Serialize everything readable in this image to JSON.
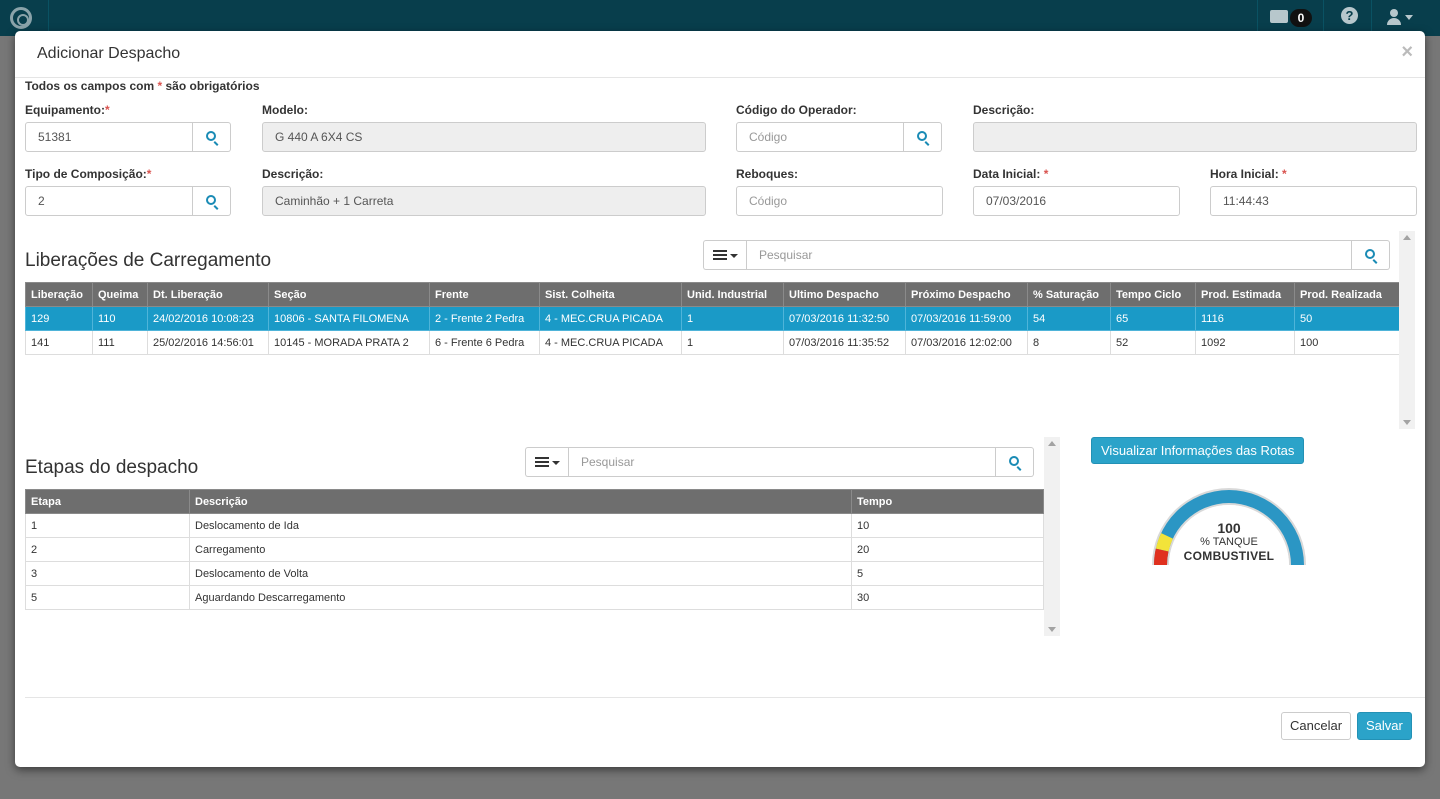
{
  "topbar": {
    "mail_count": "0",
    "help_glyph": "?"
  },
  "modal": {
    "title": "Adicionar Despacho",
    "close": "×",
    "required_note_pre": "Todos os campos com ",
    "required_star": "*",
    "required_note_post": " são obrigatórios"
  },
  "form": {
    "equipamento": {
      "label": "Equipamento:",
      "value": "51381"
    },
    "modelo": {
      "label": "Modelo:",
      "value": "G 440 A 6X4 CS"
    },
    "codigo_operador": {
      "label": "Código do Operador:",
      "placeholder": "Código"
    },
    "descricao1": {
      "label": "Descrição:",
      "value": ""
    },
    "tipo_composicao": {
      "label": "Tipo de Composição:",
      "value": "2"
    },
    "descricao2": {
      "label": "Descrição:",
      "value": "Caminhão + 1 Carreta"
    },
    "reboques": {
      "label": "Reboques:",
      "placeholder": "Código"
    },
    "data_inicial": {
      "label": "Data Inicial:",
      "value": "07/03/2016"
    },
    "hora_inicial": {
      "label": "Hora Inicial:",
      "value": "11:44:43"
    }
  },
  "liberacoes": {
    "title": "Liberações de Carregamento",
    "search_placeholder": "Pesquisar",
    "columns": [
      "Liberação",
      "Queima",
      "Dt. Liberação",
      "Seção",
      "Frente",
      "Sist. Colheita",
      "Unid. Industrial",
      "Ultimo Despacho",
      "Próximo Despacho",
      "% Saturação",
      "Tempo Ciclo",
      "Prod. Estimada",
      "Prod. Realizada"
    ],
    "rows": [
      [
        "129",
        "110",
        "24/02/2016 10:08:23",
        "10806 - SANTA FILOMENA",
        "2 - Frente 2 Pedra",
        "4 - MEC.CRUA PICADA",
        "1",
        "07/03/2016 11:32:50",
        "07/03/2016 11:59:00",
        "54",
        "65",
        "1116",
        "50"
      ],
      [
        "141",
        "111",
        "25/02/2016 14:56:01",
        "10145 - MORADA PRATA 2",
        "6 - Frente 6 Pedra",
        "4 - MEC.CRUA PICADA",
        "1",
        "07/03/2016 11:35:52",
        "07/03/2016 12:02:00",
        "8",
        "52",
        "1092",
        "100"
      ]
    ]
  },
  "etapas": {
    "title": "Etapas do despacho",
    "search_placeholder": "Pesquisar",
    "columns": [
      "Etapa",
      "Descrição",
      "Tempo"
    ],
    "rows": [
      [
        "1",
        "Deslocamento de Ida",
        "10"
      ],
      [
        "2",
        "Carregamento",
        "20"
      ],
      [
        "3",
        "Deslocamento de Volta",
        "5"
      ],
      [
        "5",
        "Aguardando Descarregamento",
        "30"
      ]
    ]
  },
  "rotas_button": "Visualizar Informações das Rotas",
  "gauge": {
    "value": "100",
    "fraction": 1.0,
    "unit": "% TANQUE",
    "label": "COMBUSTIVEL",
    "colors": {
      "fill": "#2b96c4",
      "track": "#d9d9d9",
      "warn": "#f2e33a",
      "danger": "#e0301e"
    }
  },
  "footer": {
    "cancel": "Cancelar",
    "save": "Salvar"
  }
}
